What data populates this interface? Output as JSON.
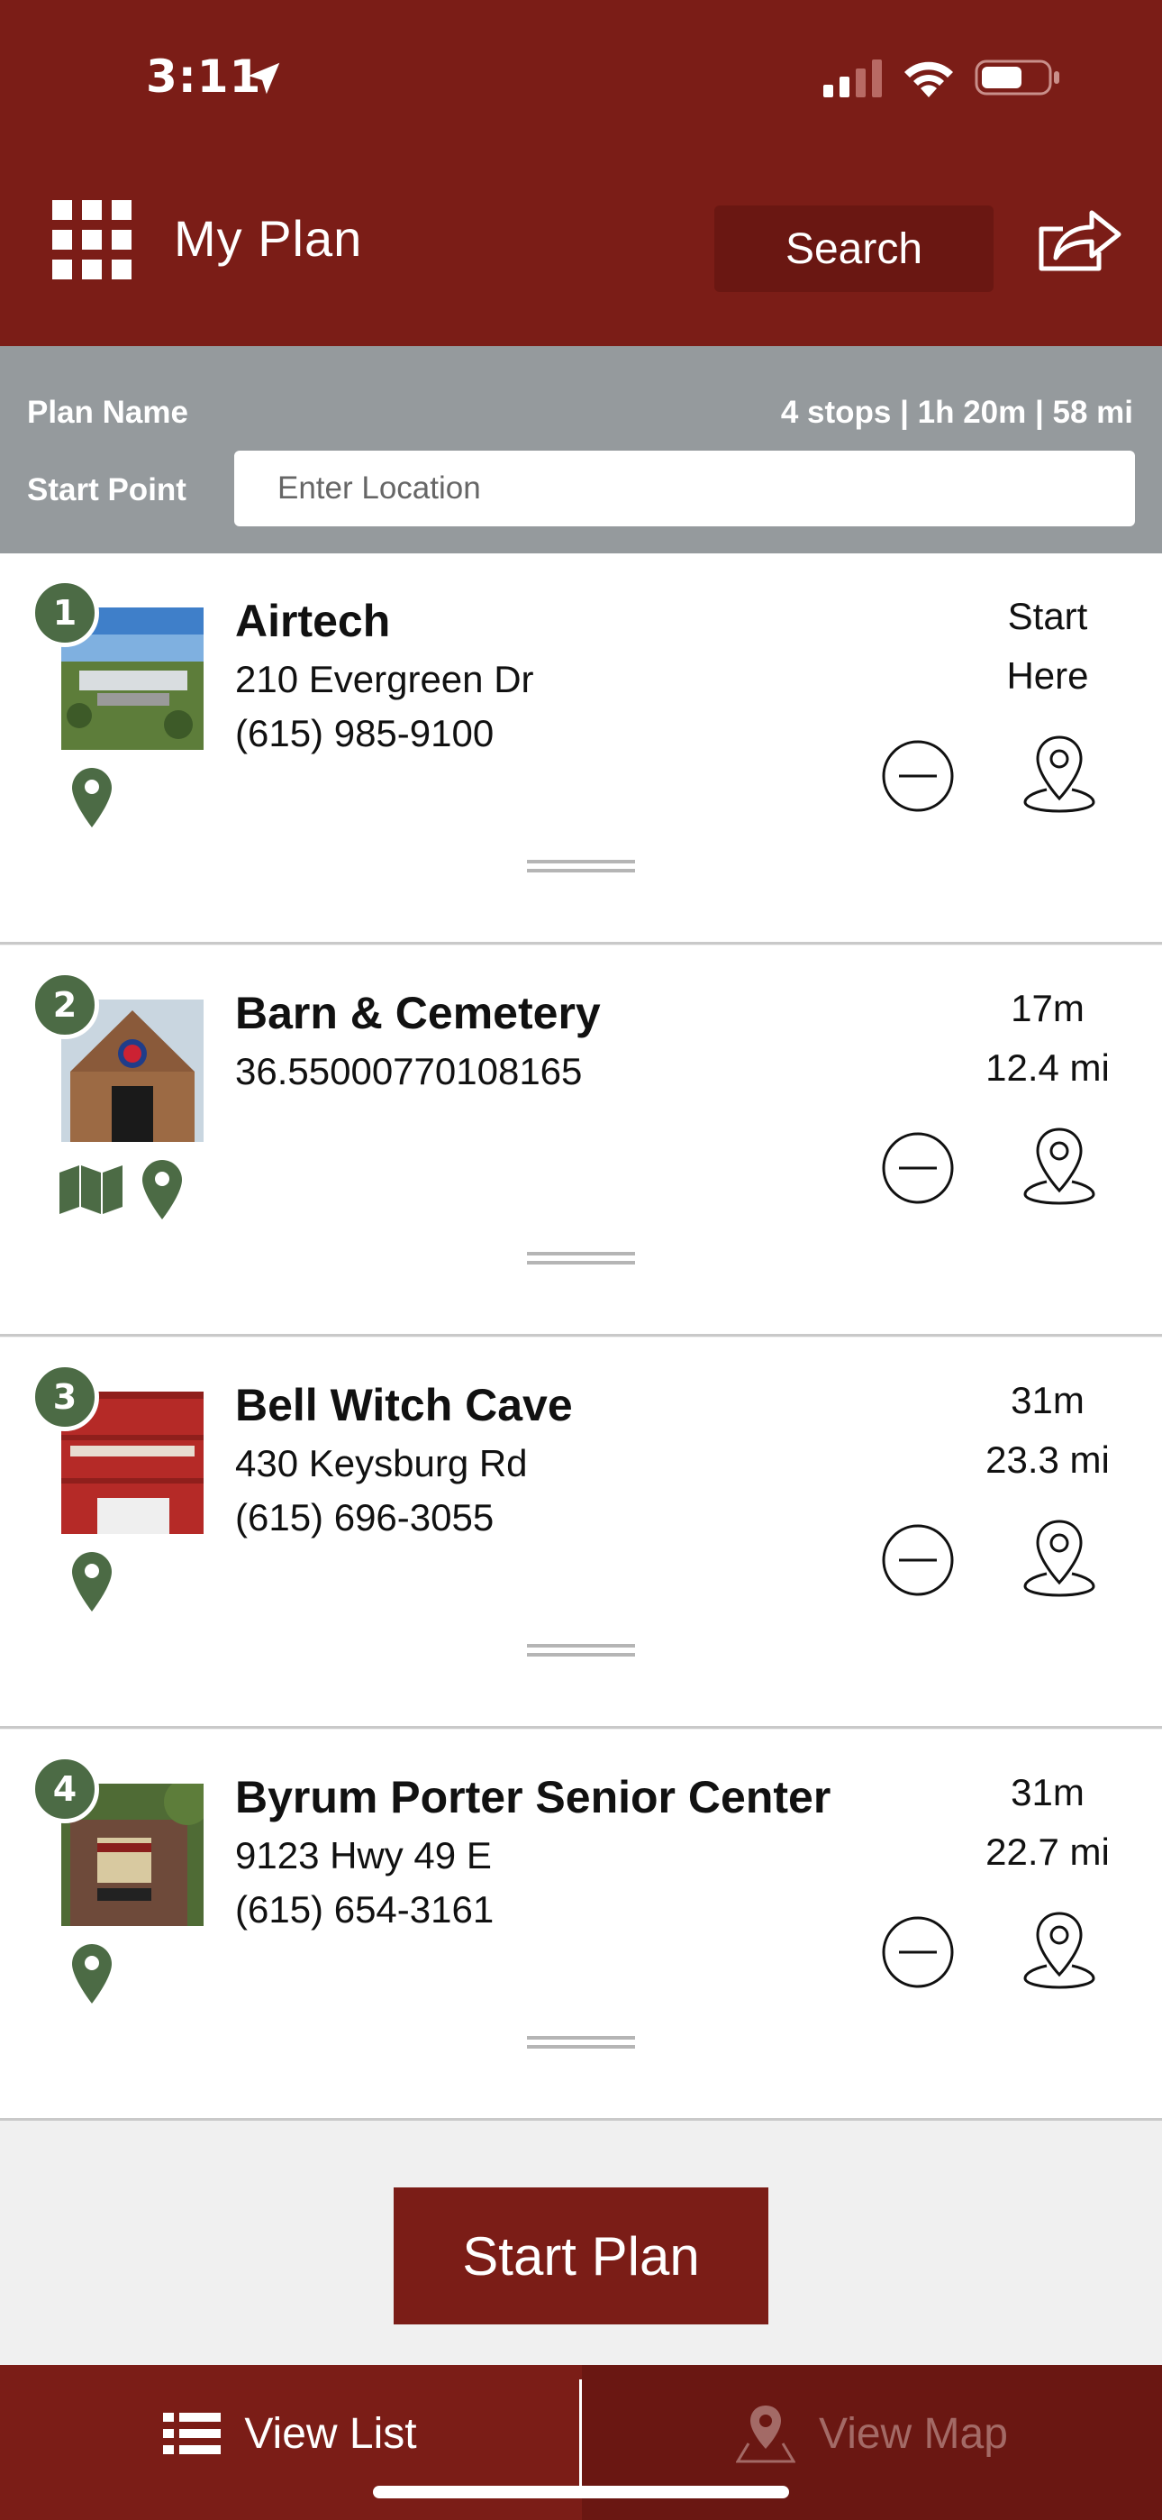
{
  "status_bar": {
    "time": "3:11"
  },
  "header": {
    "title": "My Plan",
    "search_label": "Search"
  },
  "plan": {
    "name_label": "Plan Name",
    "stats": "4 stops | 1h 20m | 58 mi",
    "start_label": "Start Point",
    "start_placeholder": "Enter Location",
    "start_value": ""
  },
  "stops": [
    {
      "number": "1",
      "name": "Airtech",
      "line1": "210 Evergreen Dr",
      "line2": "(615) 985-9100",
      "meta1": "Start",
      "meta2": "Here"
    },
    {
      "number": "2",
      "name": "Barn & Cemetery",
      "line1": "36.55000770108165",
      "line2": "",
      "meta1": "17m",
      "meta2": "12.4 mi"
    },
    {
      "number": "3",
      "name": "Bell Witch Cave",
      "line1": "430 Keysburg Rd",
      "line2": "(615) 696-3055",
      "meta1": "31m",
      "meta2": "23.3 mi"
    },
    {
      "number": "4",
      "name": "Byrum Porter Senior Center",
      "line1": "9123 Hwy 49 E",
      "line2": "(615) 654-3161",
      "meta1": "31m",
      "meta2": "22.7 mi"
    }
  ],
  "start_plan_label": "Start Plan",
  "tabs": {
    "list_label": "View List",
    "map_label": "View Map"
  },
  "colors": {
    "brand": "#7b1d17",
    "brand_dark": "#6a1712",
    "plan_bar": "#959a9d",
    "pin_green": "#4c6b45"
  },
  "icons": [
    "location-arrow-icon",
    "signal-icon",
    "wifi-icon",
    "battery-icon",
    "grid-menu-icon",
    "share-icon",
    "map-pin-icon",
    "folded-map-icon",
    "remove-circle-icon",
    "navigate-pin-icon",
    "drag-handle-icon",
    "list-icon"
  ]
}
